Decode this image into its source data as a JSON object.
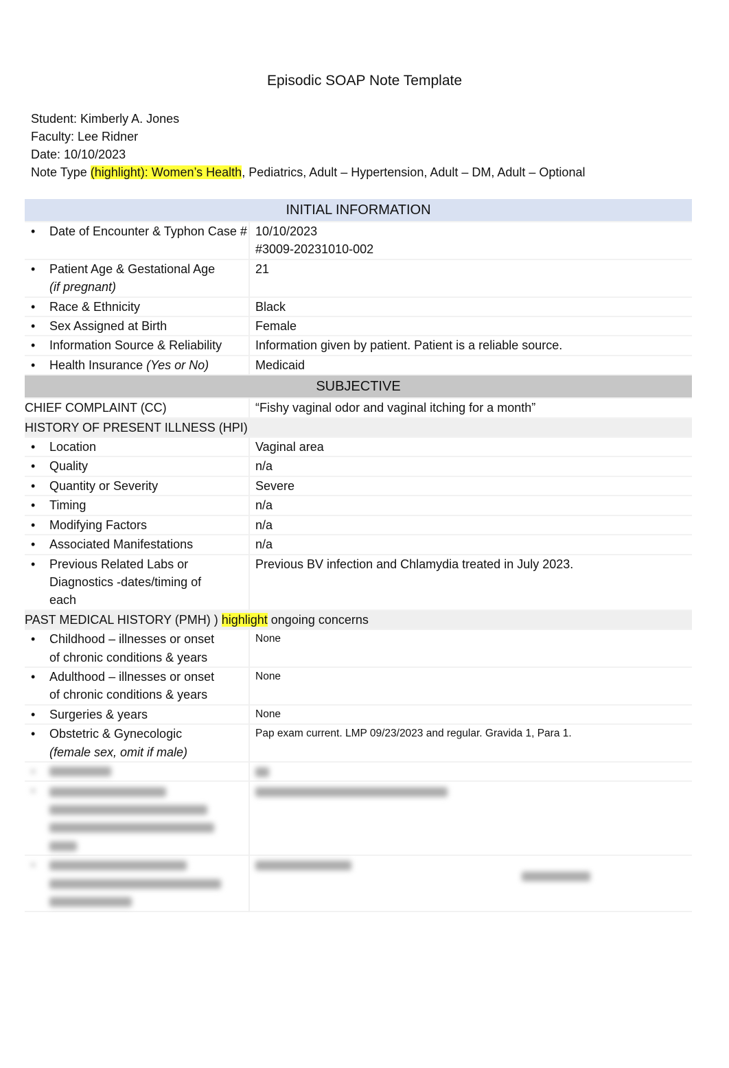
{
  "title": "Episodic SOAP Note Template",
  "meta": {
    "student": "Student: Kimberly A. Jones",
    "faculty": "Faculty: Lee Ridner",
    "date": "Date: 10/10/2023",
    "note_type_prefix": "Note Type ",
    "note_type_highlight1": "(highlight):  Women’s Health",
    "note_type_rest": ", Pediatrics, Adult – Hypertension, Adult – DM, Adult – Optional"
  },
  "colors": {
    "highlight": "#ffff3a",
    "initial_header": "#d9e1f2",
    "subjective_header": "#c6c6c6"
  },
  "initial": {
    "header": "INITIAL INFORMATION",
    "rows": [
      {
        "label": "Date of Encounter & Typhon Case #",
        "value": "10/10/2023",
        "value2": "#3009-20231010-002"
      },
      {
        "label": "Patient Age & Gestational Age",
        "label_italic": "(if pregnant)",
        "value": "21"
      },
      {
        "label": "Race & Ethnicity",
        "value": "Black"
      },
      {
        "label": "Sex Assigned at Birth",
        "value": "Female"
      },
      {
        "label": "Information Source & Reliability",
        "value": "Information given by patient. Patient is a reliable source."
      },
      {
        "label": "Health Insurance ",
        "label_italic": "(Yes or No)",
        "value": "Medicaid"
      }
    ]
  },
  "subjective": {
    "header": "SUBJECTIVE",
    "cc_label": "CHIEF COMPLAINT (CC)",
    "cc_value": "“Fishy vaginal odor and vaginal itching for a month”",
    "hpi_label": "HISTORY OF PRESENT ILLNESS (HPI)",
    "hpi": [
      {
        "label": "Location",
        "value": "Vaginal area"
      },
      {
        "label": "Quality",
        "value": "n/a"
      },
      {
        "label": "Quantity or Severity",
        "value": "Severe"
      },
      {
        "label": "Timing",
        "value": "n/a"
      },
      {
        "label": "Modifying Factors",
        "value": "n/a"
      },
      {
        "label": "Associated Manifestations",
        "value": "n/a"
      },
      {
        "label": "Previous Related Labs or Diagnostics -dates/timing of each",
        "value": "Previous BV infection and Chlamydia treated in July 2023."
      }
    ],
    "pmh_label_a": "PAST MEDICAL HISTORY (PMH) ) ",
    "pmh_label_hl": "highlight",
    "pmh_label_b": " ongoing concerns",
    "pmh": [
      {
        "label": "Childhood – illnesses or onset of chronic conditions & years",
        "value": "None"
      },
      {
        "label": "Adulthood – illnesses or onset of chronic conditions & years",
        "value": "None"
      },
      {
        "label": "Surgeries & years",
        "value": "None"
      },
      {
        "label": "Obstetric & Gynecologic",
        "label_italic": "(female sex, omit if male)",
        "value": "Pap exam current. LMP 09/23/2023 and regular. Gravida 1, Para 1."
      }
    ]
  }
}
